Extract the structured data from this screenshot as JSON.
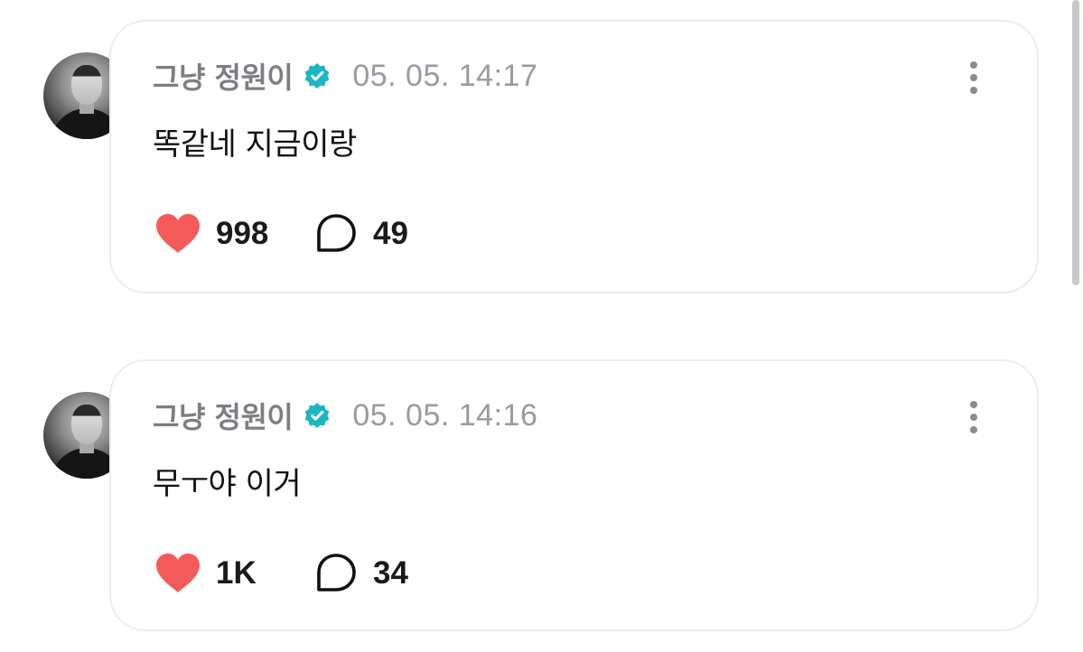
{
  "posts": [
    {
      "username": "그냥 정원이",
      "timestamp": "05. 05. 14:17",
      "text": "똑같네 지금이랑",
      "likes": "998",
      "comments": "49"
    },
    {
      "username": "그냥 정원이",
      "timestamp": "05. 05. 14:16",
      "text": "무ㅜ야 이거",
      "likes": "1K",
      "comments": "34"
    }
  ],
  "icons": {
    "verified": "verified-badge-icon",
    "more": "more-vertical-icon",
    "like": "heart-icon",
    "comment": "comment-bubble-icon"
  },
  "colors": {
    "verified": "#1db6c3",
    "heart": "#f35b5b",
    "username": "#7d7d83",
    "timestamp": "#9a9aa0",
    "card_border": "#ececf0"
  }
}
